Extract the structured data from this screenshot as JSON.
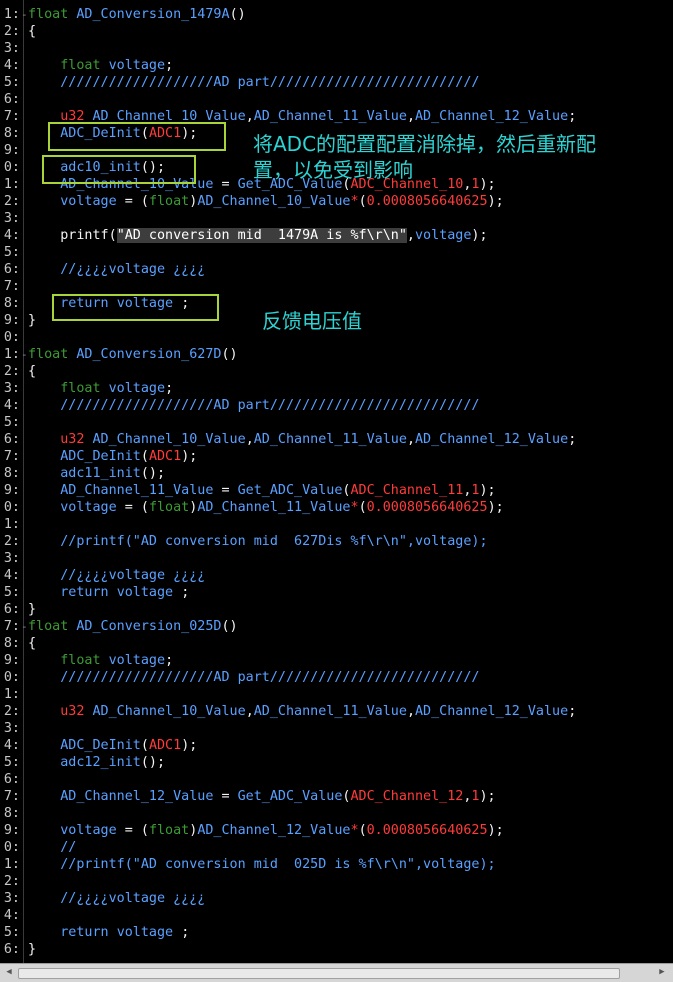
{
  "editor": {
    "lines": [
      {
        "n": "1:",
        "fold": "-",
        "tokens": [
          [
            "kw",
            "float "
          ],
          [
            "id",
            "AD_Conversion_1479A"
          ],
          [
            "sym",
            "()"
          ]
        ]
      },
      {
        "n": "2:",
        "fold": "",
        "tokens": [
          [
            "sym",
            "{"
          ]
        ]
      },
      {
        "n": "3:",
        "fold": "",
        "tokens": []
      },
      {
        "n": "4:",
        "fold": "",
        "tokens": [
          [
            "kw",
            "    float "
          ],
          [
            "id",
            "voltage"
          ],
          [
            "sym",
            ";"
          ]
        ]
      },
      {
        "n": "5:",
        "fold": "",
        "tokens": [
          [
            "cm",
            "    ///////////////////AD part//////////////////////////"
          ]
        ]
      },
      {
        "n": "6:",
        "fold": "",
        "tokens": []
      },
      {
        "n": "7:",
        "fold": "",
        "tokens": [
          [
            "red",
            "    u32 "
          ],
          [
            "id",
            "AD_Channel_10_Value"
          ],
          [
            "sym",
            ","
          ],
          [
            "id",
            "AD_Channel_11_Value"
          ],
          [
            "sym",
            ","
          ],
          [
            "id",
            "AD_Channel_12_Value"
          ],
          [
            "sym",
            ";"
          ]
        ]
      },
      {
        "n": "8:",
        "fold": "",
        "tokens": [
          [
            "id",
            "    ADC_DeInit"
          ],
          [
            "sym",
            "("
          ],
          [
            "red",
            "ADC1"
          ],
          [
            "sym",
            ");"
          ]
        ]
      },
      {
        "n": "9:",
        "fold": "",
        "tokens": []
      },
      {
        "n": "0:",
        "fold": "",
        "tokens": [
          [
            "id",
            "    adc10_init"
          ],
          [
            "sym",
            "();"
          ]
        ]
      },
      {
        "n": "1:",
        "fold": "",
        "tokens": [
          [
            "id",
            "    AD_Channel_10_Value "
          ],
          [
            "sym",
            "= "
          ],
          [
            "id",
            "Get_ADC_Value"
          ],
          [
            "sym",
            "("
          ],
          [
            "red",
            "ADC_Channel_10"
          ],
          [
            "sym",
            ","
          ],
          [
            "red",
            "1"
          ],
          [
            "sym",
            ");"
          ]
        ]
      },
      {
        "n": "2:",
        "fold": "",
        "tokens": [
          [
            "id",
            "    voltage "
          ],
          [
            "sym",
            "= ("
          ],
          [
            "kw",
            "float"
          ],
          [
            "sym",
            ")"
          ],
          [
            "id",
            "AD_Channel_10_Value"
          ],
          [
            "red",
            "*"
          ],
          [
            "sym",
            "("
          ],
          [
            "red",
            "0.0008056640625"
          ],
          [
            "sym",
            ");"
          ]
        ]
      },
      {
        "n": "3:",
        "fold": "",
        "tokens": []
      },
      {
        "n": "4:",
        "fold": "",
        "tokens": [
          [
            "sym",
            "    printf("
          ],
          [
            "hlbg",
            "\"AD conversion mid  1479A is %f\\r\\n\""
          ],
          [
            "sym",
            ","
          ],
          [
            "id",
            "voltage"
          ],
          [
            "sym",
            ");"
          ]
        ]
      },
      {
        "n": "5:",
        "fold": "",
        "tokens": []
      },
      {
        "n": "6:",
        "fold": "",
        "tokens": [
          [
            "cm",
            "    //¿¿¿¿voltage ¿¿¿¿"
          ]
        ]
      },
      {
        "n": "7:",
        "fold": "",
        "tokens": []
      },
      {
        "n": "8:",
        "fold": "",
        "tokens": [
          [
            "fn",
            "    return "
          ],
          [
            "id",
            "voltage "
          ],
          [
            "sym",
            ";"
          ]
        ]
      },
      {
        "n": "9:",
        "fold": "",
        "tokens": [
          [
            "sym",
            "}"
          ]
        ]
      },
      {
        "n": "0:",
        "fold": "",
        "tokens": []
      },
      {
        "n": "1:",
        "fold": "-",
        "tokens": [
          [
            "kw",
            "float "
          ],
          [
            "id",
            "AD_Conversion_627D"
          ],
          [
            "sym",
            "()"
          ]
        ]
      },
      {
        "n": "2:",
        "fold": "",
        "tokens": [
          [
            "sym",
            "{"
          ]
        ]
      },
      {
        "n": "3:",
        "fold": "",
        "tokens": [
          [
            "kw",
            "    float "
          ],
          [
            "id",
            "voltage"
          ],
          [
            "sym",
            ";"
          ]
        ]
      },
      {
        "n": "4:",
        "fold": "",
        "tokens": [
          [
            "cm",
            "    ///////////////////AD part//////////////////////////"
          ]
        ]
      },
      {
        "n": "5:",
        "fold": "",
        "tokens": []
      },
      {
        "n": "6:",
        "fold": "",
        "tokens": [
          [
            "red",
            "    u32 "
          ],
          [
            "id",
            "AD_Channel_10_Value"
          ],
          [
            "sym",
            ","
          ],
          [
            "id",
            "AD_Channel_11_Value"
          ],
          [
            "sym",
            ","
          ],
          [
            "id",
            "AD_Channel_12_Value"
          ],
          [
            "sym",
            ";"
          ]
        ]
      },
      {
        "n": "7:",
        "fold": "",
        "tokens": [
          [
            "id",
            "    ADC_DeInit"
          ],
          [
            "sym",
            "("
          ],
          [
            "red",
            "ADC1"
          ],
          [
            "sym",
            ");"
          ]
        ]
      },
      {
        "n": "8:",
        "fold": "",
        "tokens": [
          [
            "id",
            "    adc11_init"
          ],
          [
            "sym",
            "();"
          ]
        ]
      },
      {
        "n": "9:",
        "fold": "",
        "tokens": [
          [
            "id",
            "    AD_Channel_11_Value "
          ],
          [
            "sym",
            "= "
          ],
          [
            "id",
            "Get_ADC_Value"
          ],
          [
            "sym",
            "("
          ],
          [
            "red",
            "ADC_Channel_11"
          ],
          [
            "sym",
            ","
          ],
          [
            "red",
            "1"
          ],
          [
            "sym",
            ");"
          ]
        ]
      },
      {
        "n": "0:",
        "fold": "",
        "tokens": [
          [
            "id",
            "    voltage "
          ],
          [
            "sym",
            "= ("
          ],
          [
            "kw",
            "float"
          ],
          [
            "sym",
            ")"
          ],
          [
            "id",
            "AD_Channel_11_Value"
          ],
          [
            "red",
            "*"
          ],
          [
            "sym",
            "("
          ],
          [
            "red",
            "0.0008056640625"
          ],
          [
            "sym",
            ");"
          ]
        ]
      },
      {
        "n": "1:",
        "fold": "",
        "tokens": []
      },
      {
        "n": "2:",
        "fold": "",
        "tokens": [
          [
            "cm",
            "    //printf(\"AD conversion mid  627Dis %f\\r\\n\",voltage);"
          ]
        ]
      },
      {
        "n": "3:",
        "fold": "",
        "tokens": []
      },
      {
        "n": "4:",
        "fold": "",
        "tokens": [
          [
            "cm",
            "    //¿¿¿¿voltage ¿¿¿¿"
          ]
        ]
      },
      {
        "n": "5:",
        "fold": "",
        "tokens": [
          [
            "fn",
            "    return "
          ],
          [
            "id",
            "voltage "
          ],
          [
            "sym",
            ";"
          ]
        ]
      },
      {
        "n": "6:",
        "fold": "",
        "tokens": [
          [
            "sym",
            "}"
          ]
        ]
      },
      {
        "n": "7:",
        "fold": "-",
        "tokens": [
          [
            "kw",
            "float "
          ],
          [
            "id",
            "AD_Conversion_025D"
          ],
          [
            "sym",
            "()"
          ]
        ]
      },
      {
        "n": "8:",
        "fold": "",
        "tokens": [
          [
            "sym",
            "{"
          ]
        ]
      },
      {
        "n": "9:",
        "fold": "",
        "tokens": [
          [
            "kw",
            "    float "
          ],
          [
            "id",
            "voltage"
          ],
          [
            "sym",
            ";"
          ]
        ]
      },
      {
        "n": "0:",
        "fold": "",
        "tokens": [
          [
            "cm",
            "    ///////////////////AD part//////////////////////////"
          ]
        ]
      },
      {
        "n": "1:",
        "fold": "",
        "tokens": []
      },
      {
        "n": "2:",
        "fold": "",
        "tokens": [
          [
            "red",
            "    u32 "
          ],
          [
            "id",
            "AD_Channel_10_Value"
          ],
          [
            "sym",
            ","
          ],
          [
            "id",
            "AD_Channel_11_Value"
          ],
          [
            "sym",
            ","
          ],
          [
            "id",
            "AD_Channel_12_Value"
          ],
          [
            "sym",
            ";"
          ]
        ]
      },
      {
        "n": "3:",
        "fold": "",
        "tokens": []
      },
      {
        "n": "4:",
        "fold": "",
        "tokens": [
          [
            "id",
            "    ADC_DeInit"
          ],
          [
            "sym",
            "("
          ],
          [
            "red",
            "ADC1"
          ],
          [
            "sym",
            ");"
          ]
        ]
      },
      {
        "n": "5:",
        "fold": "",
        "tokens": [
          [
            "id",
            "    adc12_init"
          ],
          [
            "sym",
            "();"
          ]
        ]
      },
      {
        "n": "6:",
        "fold": "",
        "tokens": []
      },
      {
        "n": "7:",
        "fold": "",
        "tokens": [
          [
            "id",
            "    AD_Channel_12_Value "
          ],
          [
            "sym",
            "= "
          ],
          [
            "id",
            "Get_ADC_Value"
          ],
          [
            "sym",
            "("
          ],
          [
            "red",
            "ADC_Channel_12"
          ],
          [
            "sym",
            ","
          ],
          [
            "red",
            "1"
          ],
          [
            "sym",
            ");"
          ]
        ]
      },
      {
        "n": "8:",
        "fold": "",
        "tokens": []
      },
      {
        "n": "9:",
        "fold": "",
        "tokens": [
          [
            "id",
            "    voltage "
          ],
          [
            "sym",
            "= ("
          ],
          [
            "kw",
            "float"
          ],
          [
            "sym",
            ")"
          ],
          [
            "id",
            "AD_Channel_12_Value"
          ],
          [
            "red",
            "*"
          ],
          [
            "sym",
            "("
          ],
          [
            "red",
            "0.0008056640625"
          ],
          [
            "sym",
            ");"
          ]
        ]
      },
      {
        "n": "0:",
        "fold": "",
        "tokens": [
          [
            "cm",
            "    //"
          ]
        ]
      },
      {
        "n": "1:",
        "fold": "",
        "tokens": [
          [
            "cm",
            "    //printf(\"AD conversion mid  025D is %f\\r\\n\",voltage);"
          ]
        ]
      },
      {
        "n": "2:",
        "fold": "",
        "tokens": []
      },
      {
        "n": "3:",
        "fold": "",
        "tokens": [
          [
            "cm",
            "    //¿¿¿¿voltage ¿¿¿¿"
          ]
        ]
      },
      {
        "n": "4:",
        "fold": "",
        "tokens": []
      },
      {
        "n": "5:",
        "fold": "",
        "tokens": [
          [
            "fn",
            "    return "
          ],
          [
            "id",
            "voltage "
          ],
          [
            "sym",
            ";"
          ]
        ]
      },
      {
        "n": "6:",
        "fold": "",
        "tokens": [
          [
            "sym",
            "}"
          ]
        ]
      }
    ]
  },
  "annotations": {
    "note_reinit_line1": "将ADC的配置配置消除掉，然后重新配",
    "note_reinit_line2": "置，以免受到影响",
    "note_return": "反馈电压值",
    "box_color": "#a8d43a",
    "note_color": "#2ed4d4"
  },
  "scrollbar": {
    "left_arrow": "◀",
    "right_arrow": "▶"
  }
}
